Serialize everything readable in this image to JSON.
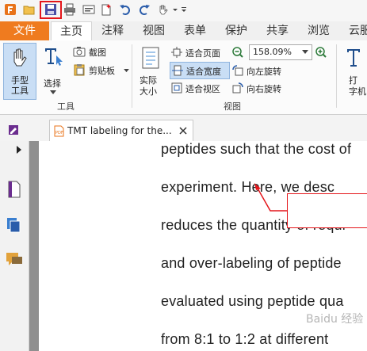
{
  "ribbon_tabs": [
    "文件",
    "主页",
    "注释",
    "视图",
    "表单",
    "保护",
    "共享",
    "浏览",
    "云服"
  ],
  "home_tab": {
    "hand_tool": "手型\n工具",
    "select": "选择",
    "screenshot": "截图",
    "clipboard": "剪贴板",
    "group_tools": "工具",
    "actual_size": "实际\n大小",
    "fit_page": "适合页面",
    "fit_width": "适合宽度",
    "fit_view": "适合视区",
    "zoom_value": "158.09%",
    "rotate_left": "向左旋转",
    "rotate_right": "向右旋转",
    "group_view": "视图",
    "typewriter": "打\n字机"
  },
  "document": {
    "tab_title": "TMT labeling for the...",
    "lines": [
      "peptides such that the cost of",
      "experiment. Here, we desc",
      "reduces the quantity of requi",
      "and over-labeling of peptide",
      "evaluated using peptide qua",
      "from 8:1 to 1:2 at different"
    ]
  },
  "watermark": "Baidu 经验",
  "colors": {
    "file_tab": "#ef7b1f",
    "highlight": "#e4161b"
  }
}
